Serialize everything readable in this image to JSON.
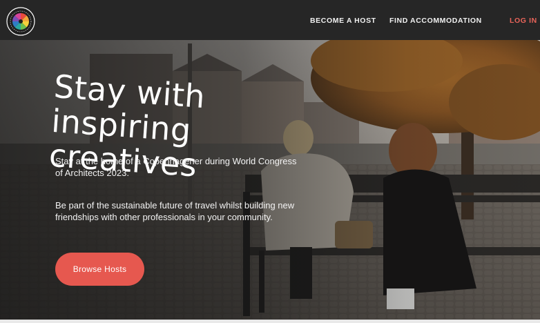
{
  "logo": {
    "name": "World Congress of Architects Copenhagen logo"
  },
  "nav": {
    "become_host": "BECOME A HOST",
    "find_accommodation": "FIND ACCOMMODATION",
    "log_in": "LOG IN"
  },
  "hero": {
    "headline": "Stay with inspiring creatives",
    "paragraph_1": "Stay at the home of a Copenhagener during World Congress of Architects 2023.",
    "paragraph_2": "Be part of the sustainable future of travel whilst building new friendships with other professionals in your community.",
    "cta_label": "Browse Hosts"
  },
  "colors": {
    "nav_background": "#262626",
    "accent": "#e6584f",
    "login_text": "#e9645a",
    "text_light": "#ffffff"
  }
}
